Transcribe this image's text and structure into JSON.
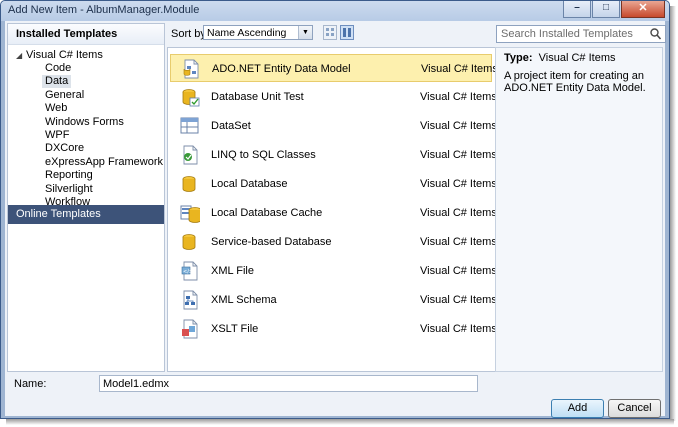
{
  "window": {
    "title": "Add New Item - AlbumManager.Module",
    "minimize": "–",
    "maximize": "□",
    "close": "✕"
  },
  "sidebar": {
    "installed_header": "Installed Templates",
    "root": "Visual C# Items",
    "items": [
      {
        "label": "Code"
      },
      {
        "label": "Data"
      },
      {
        "label": "General"
      },
      {
        "label": "Web"
      },
      {
        "label": "Windows Forms"
      },
      {
        "label": "WPF"
      },
      {
        "label": "DXCore"
      },
      {
        "label": "eXpressApp Framework"
      },
      {
        "label": "Reporting"
      },
      {
        "label": "Silverlight"
      },
      {
        "label": "Workflow"
      }
    ],
    "selected": "Data",
    "online": "Online Templates"
  },
  "toolbar": {
    "sort_label": "Sort by:",
    "sort_value": "Name Ascending",
    "search_placeholder": "Search Installed Templates"
  },
  "templates": [
    {
      "name": "ADO.NET Entity Data Model",
      "type": "Visual C# Items",
      "icon": "entity-model-icon",
      "selected": true
    },
    {
      "name": "Database Unit Test",
      "type": "Visual C# Items",
      "icon": "unit-test-icon"
    },
    {
      "name": "DataSet",
      "type": "Visual C# Items",
      "icon": "dataset-icon"
    },
    {
      "name": "LINQ to SQL Classes",
      "type": "Visual C# Items",
      "icon": "linq-icon"
    },
    {
      "name": "Local Database",
      "type": "Visual C# Items",
      "icon": "database-icon"
    },
    {
      "name": "Local Database Cache",
      "type": "Visual C# Items",
      "icon": "database-cache-icon"
    },
    {
      "name": "Service-based Database",
      "type": "Visual C# Items",
      "icon": "service-database-icon"
    },
    {
      "name": "XML File",
      "type": "Visual C# Items",
      "icon": "xml-file-icon"
    },
    {
      "name": "XML Schema",
      "type": "Visual C# Items",
      "icon": "xml-schema-icon"
    },
    {
      "name": "XSLT File",
      "type": "Visual C# Items",
      "icon": "xslt-file-icon"
    }
  ],
  "details": {
    "type_label": "Type:",
    "type_value": "Visual C# Items",
    "description": "A project item for creating an ADO.NET Entity Data Model."
  },
  "name_field": {
    "label": "Name:",
    "value": "Model1.edmx"
  },
  "buttons": {
    "add": "Add",
    "cancel": "Cancel"
  },
  "colors": {
    "selection": "#fdf0ae",
    "online_bg": "#3d5379",
    "frame": "#9fb5d2"
  }
}
